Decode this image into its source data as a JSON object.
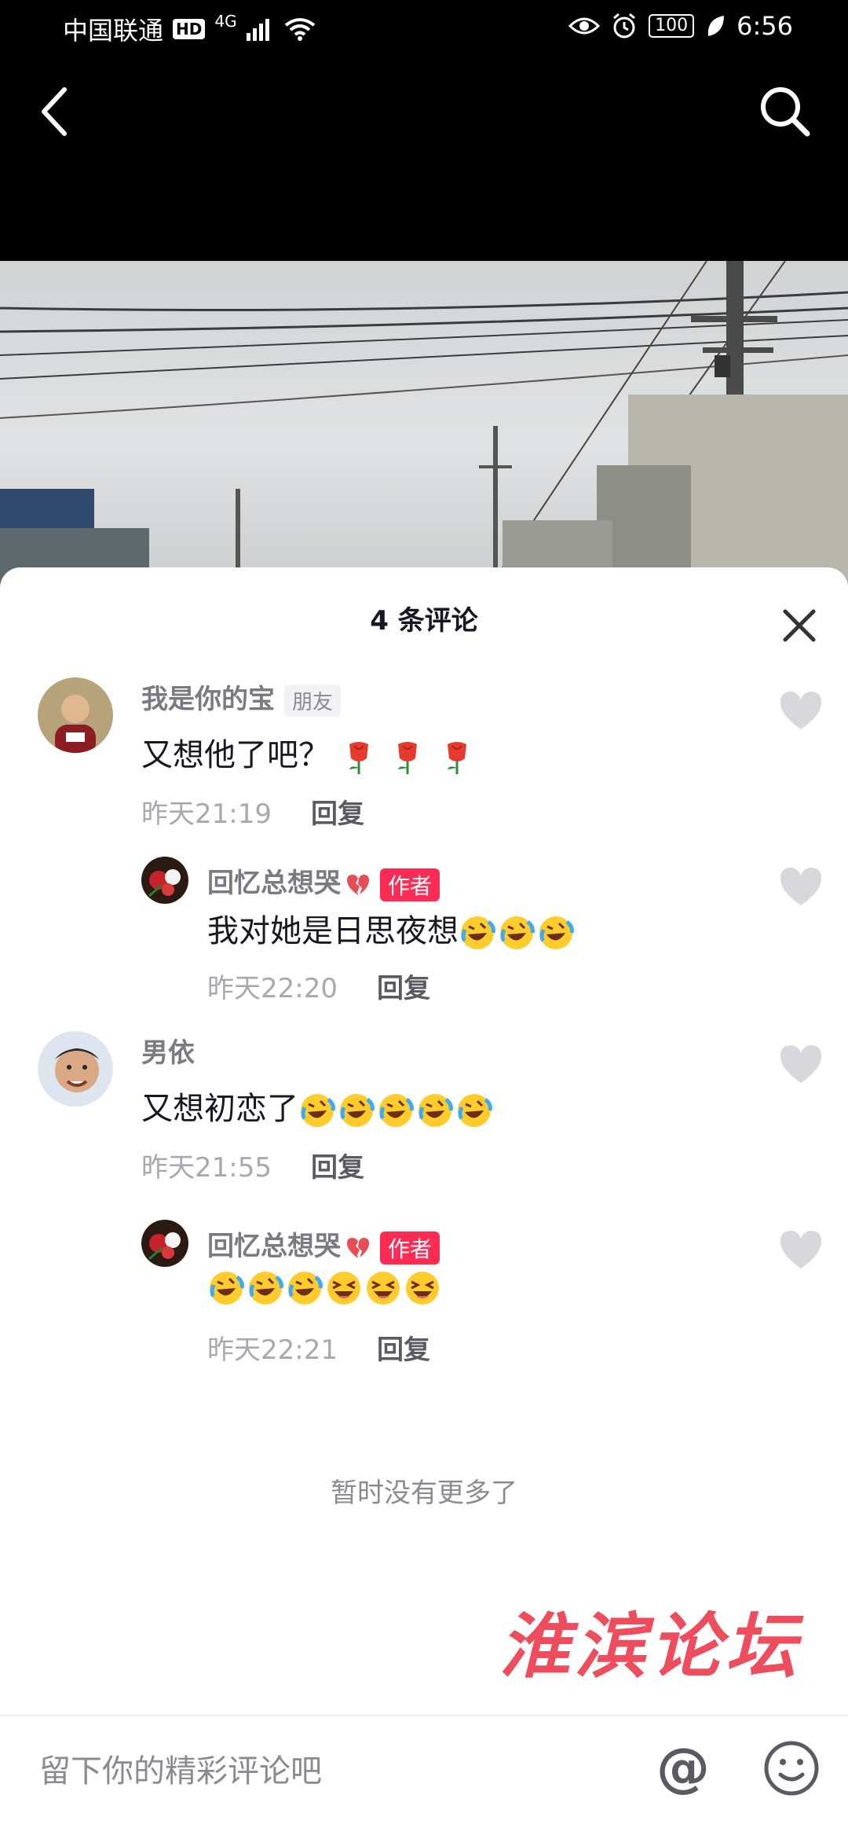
{
  "status_bar": {
    "carrier": "中国联通",
    "hd": "HD",
    "network": "4G",
    "battery": "100",
    "time": "6:56"
  },
  "nav": {
    "back_icon": "back-chevron-icon",
    "search_icon": "search-icon"
  },
  "comments_sheet": {
    "title": "4 条评论",
    "close_icon": "close-icon",
    "comments": [
      {
        "author": "我是你的宝",
        "badge": "朋友",
        "text": "又想他了吧？",
        "emojis": [
          "rose",
          "rose",
          "rose"
        ],
        "time": "昨天21:19",
        "reply_label": "回复"
      },
      {
        "author": "回忆总想哭",
        "badge": "作者",
        "text": "我对她是日思夜想",
        "emojis": [
          "rofl",
          "rofl",
          "rofl"
        ],
        "time": "昨天22:20",
        "reply_label": "回复"
      },
      {
        "author": "男依",
        "badge": "",
        "text": "又想初恋了",
        "emojis": [
          "rofl",
          "rofl",
          "rofl",
          "rofl",
          "rofl"
        ],
        "time": "昨天21:55",
        "reply_label": "回复"
      },
      {
        "author": "回忆总想哭",
        "badge": "作者",
        "text": "",
        "emojis": [
          "rofl",
          "rofl",
          "rofl",
          "squint",
          "squint",
          "squint"
        ],
        "time": "昨天22:21",
        "reply_label": "回复"
      }
    ],
    "no_more": "暂时没有更多了"
  },
  "watermark": "淮滨论坛",
  "input_bar": {
    "placeholder": "留下你的精彩评论吧",
    "at_label": "@"
  },
  "colors": {
    "accent": "#fe2c55",
    "watermark": "#ee4455"
  }
}
